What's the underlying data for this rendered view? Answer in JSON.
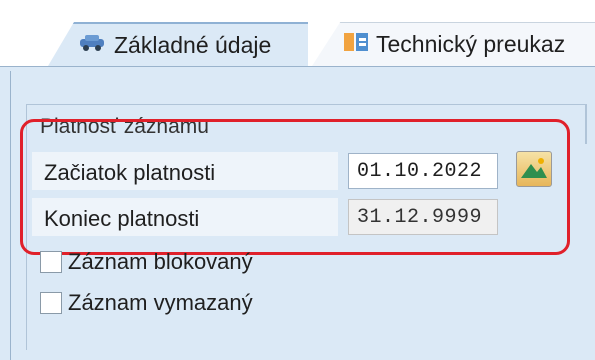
{
  "tabs": [
    {
      "label": "Základné údaje",
      "icon": "car-icon",
      "active": true
    },
    {
      "label": "Technický preukaz",
      "icon": "document-id-icon",
      "active": false
    }
  ],
  "validity": {
    "group_title": "Platnosť záznamu",
    "start_label": "Začiatok platnosti",
    "start_value": "01.10.2022",
    "end_label": "Koniec platnosti",
    "end_value": "31.12.9999",
    "calendar_icon": "calendar-picker-icon"
  },
  "flags": [
    {
      "label": "Záznam blokovaný",
      "checked": false
    },
    {
      "label": "Záznam vymazaný",
      "checked": false
    }
  ],
  "colors": {
    "panel": "#dbe9f6",
    "highlight": "#e0202a"
  }
}
